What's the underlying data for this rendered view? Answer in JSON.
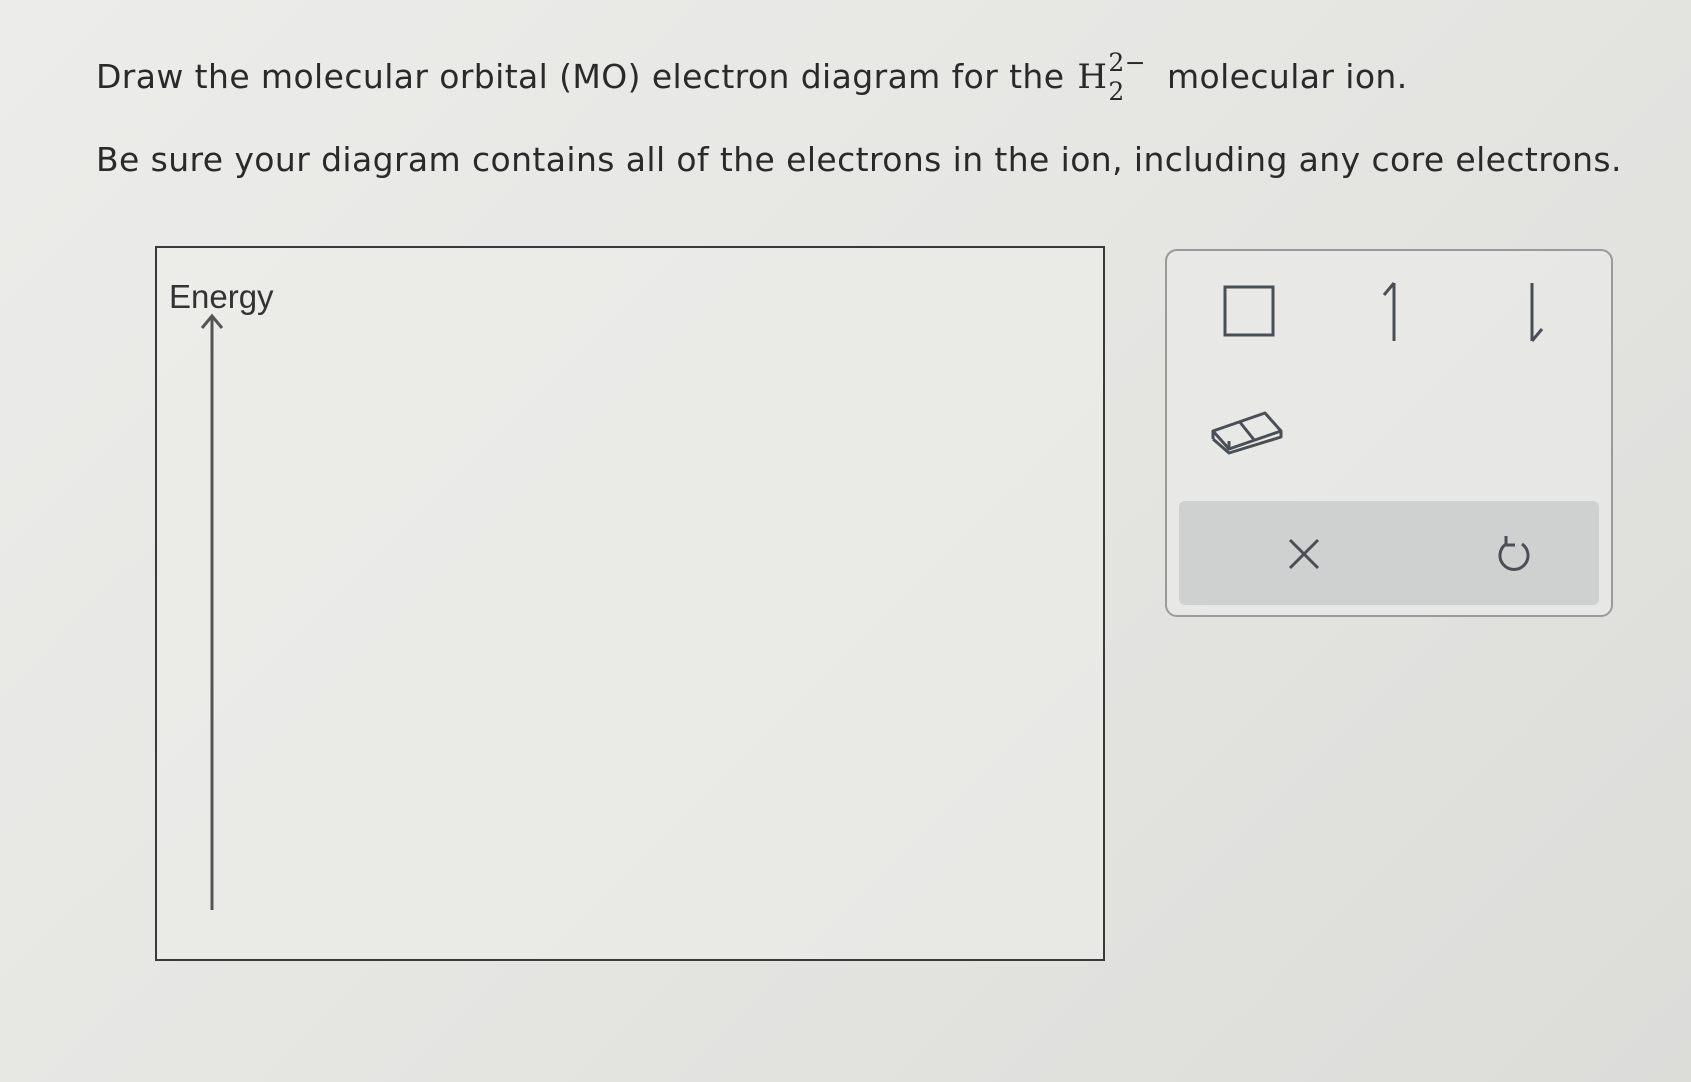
{
  "question": {
    "text_before": "Draw the molecular orbital (MO) electron diagram for the",
    "formula_base": "H",
    "formula_charge": "2−",
    "formula_subscript": "2",
    "text_after": "molecular ion.",
    "instruction": "Be sure your diagram contains all of the electrons in the ion, including any core electrons."
  },
  "canvas": {
    "axis_label": "Energy"
  },
  "toolbox": {
    "tools": [
      "orbital-box-icon",
      "spin-up-arrow-icon",
      "spin-down-arrow-icon",
      "eraser-icon"
    ],
    "actions": [
      "clear-x-icon",
      "undo-icon"
    ]
  },
  "colors": {
    "action_bar": "#cfd1d1",
    "icon_stroke": "#4a4f55",
    "border": "#3a3a3a"
  }
}
